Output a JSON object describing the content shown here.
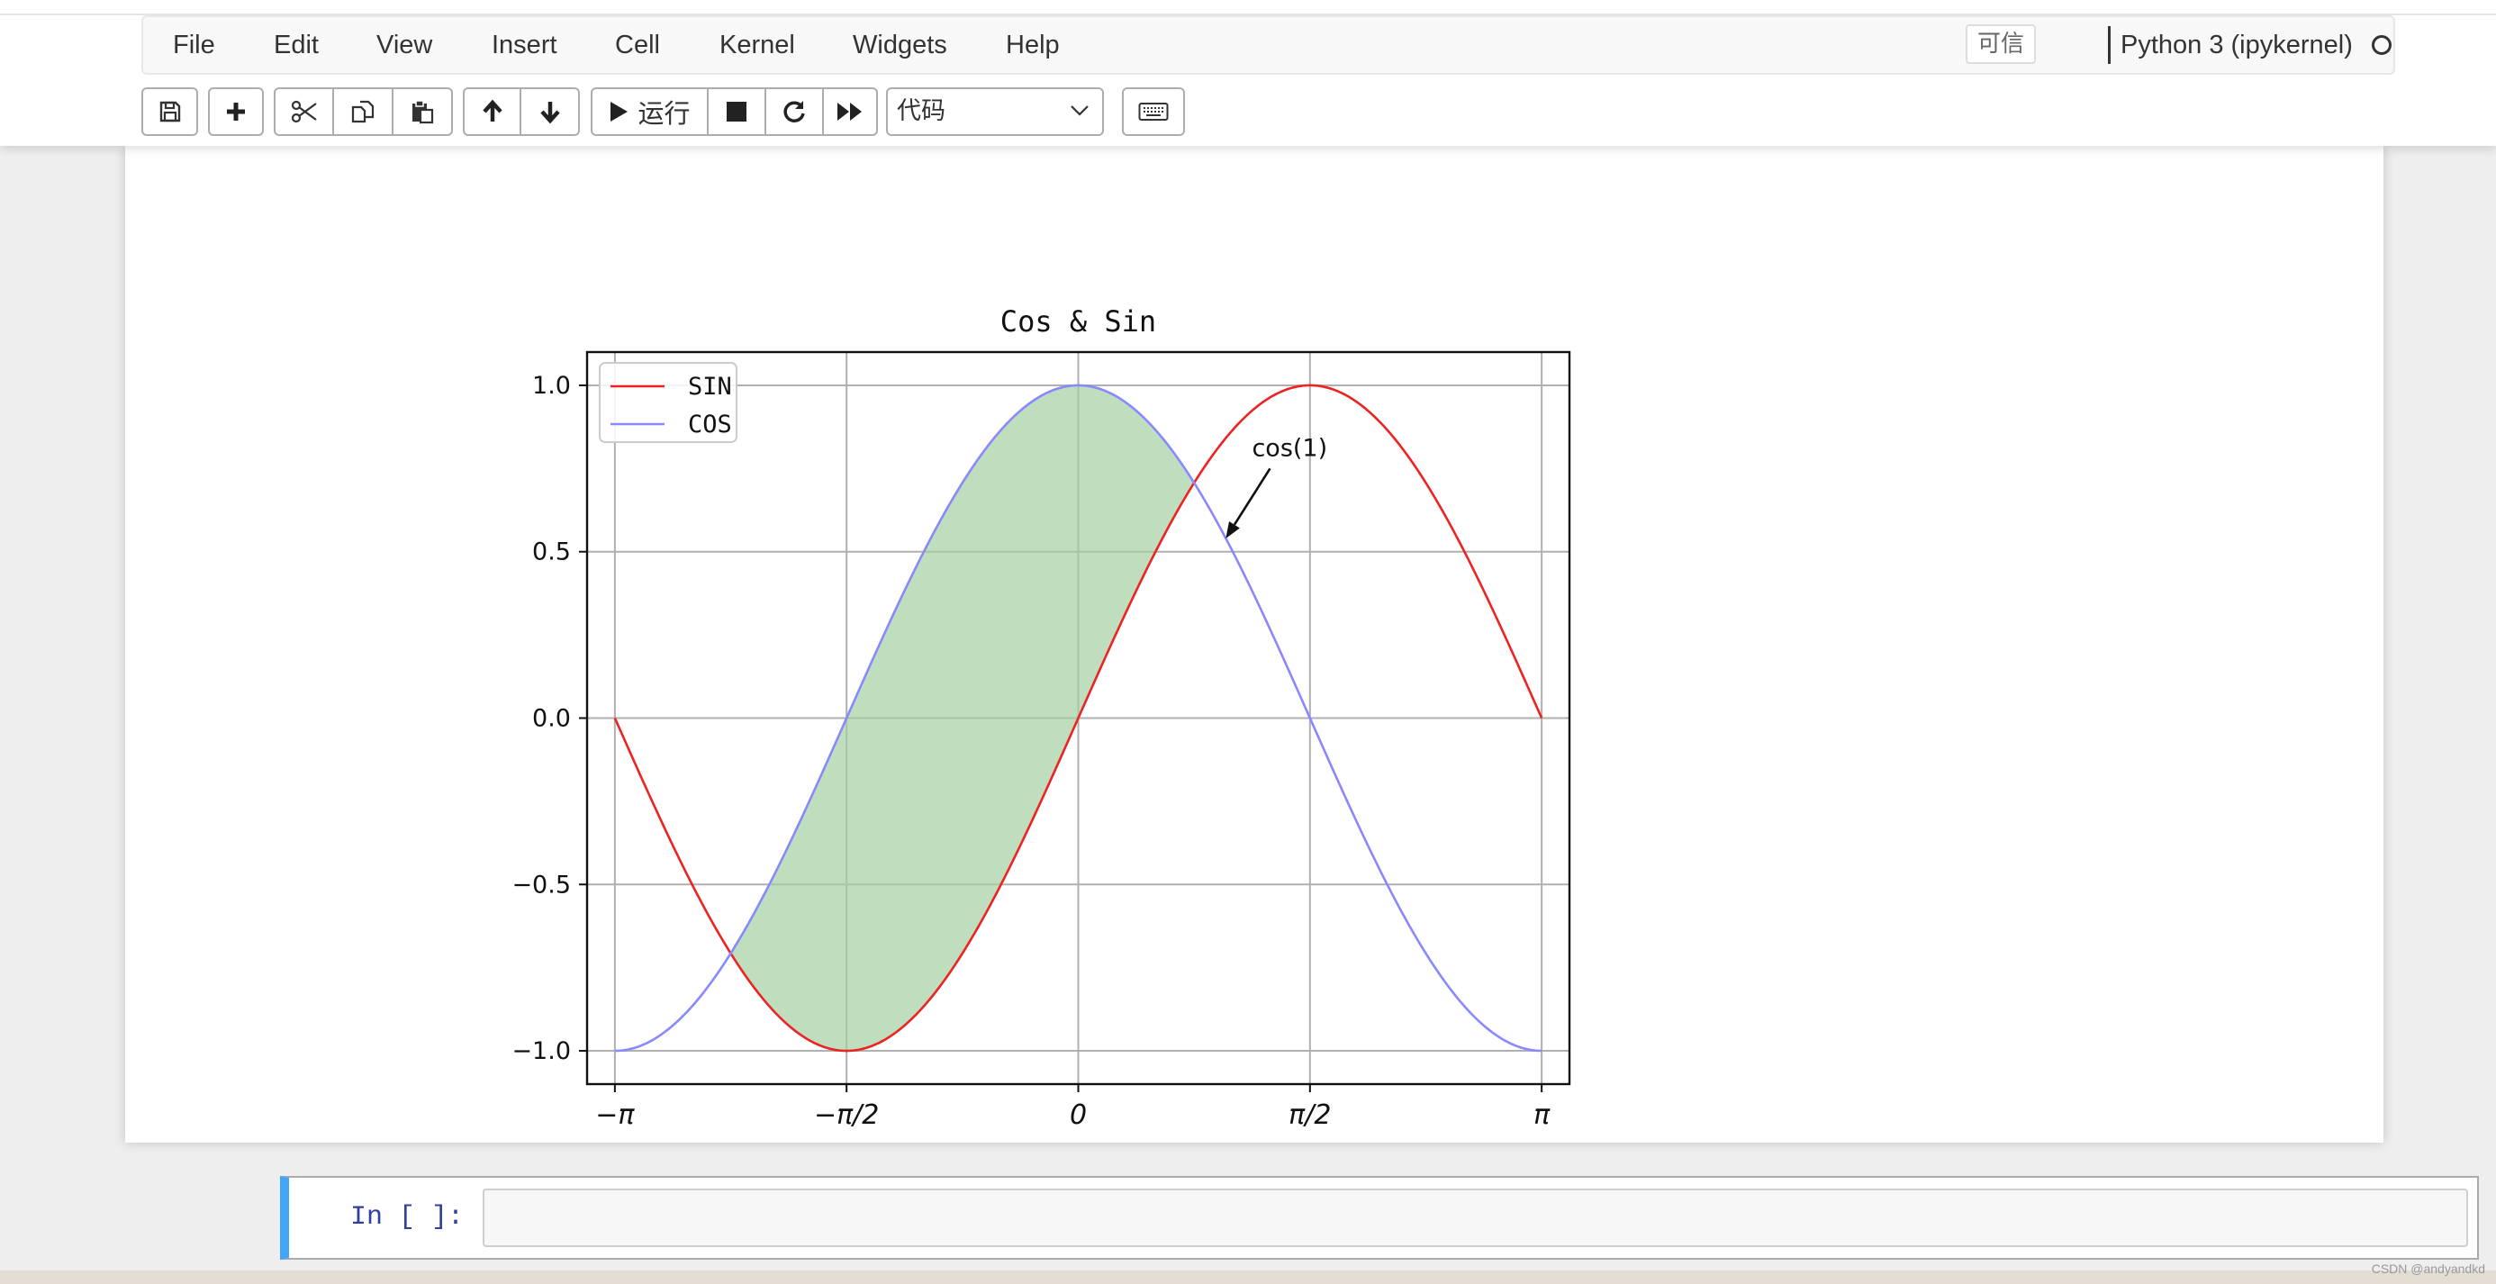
{
  "menu": {
    "items": [
      "File",
      "Edit",
      "View",
      "Insert",
      "Cell",
      "Kernel",
      "Widgets",
      "Help"
    ],
    "trusted": "可信",
    "kernel": "Python 3 (ipykernel)"
  },
  "toolbar": {
    "buttons": [
      "save-icon",
      "plus-icon",
      "scissors-icon",
      "copy-icon",
      "paste-icon",
      "arrow-up-icon",
      "arrow-down-icon",
      "play-icon",
      "stop-icon",
      "restart-icon",
      "fast-forward-icon",
      "keyboard-icon"
    ],
    "run_label": "运行",
    "cell_type": "代码"
  },
  "cell": {
    "prompt": "In [ ]:",
    "code": ""
  },
  "chart_data": {
    "type": "line",
    "title": "Cos & Sin",
    "xlabel": "",
    "ylabel": "",
    "xlim": [
      -3.33,
      3.33
    ],
    "ylim": [
      -1.1,
      1.1
    ],
    "x_ticks": [
      -3.14159,
      -1.5708,
      0,
      1.5708,
      3.14159
    ],
    "x_tick_labels": [
      "−π",
      "−π/2",
      "0",
      "π/2",
      "π"
    ],
    "y_ticks": [
      -1.0,
      -0.5,
      0.0,
      0.5,
      1.0
    ],
    "y_tick_labels": [
      "−1.0",
      "−0.5",
      "0.0",
      "0.5",
      "1.0"
    ],
    "grid": true,
    "legend": "top-left",
    "series": [
      {
        "name": "SIN",
        "function": "sin",
        "color": "#ee2222",
        "x_range": [
          -3.14159,
          3.14159
        ]
      },
      {
        "name": "COS",
        "function": "cos",
        "color": "#8888ff",
        "x_range": [
          -3.14159,
          3.14159
        ]
      }
    ],
    "fill_between": {
      "where": "cos > sin",
      "color": "#a2d0a2"
    },
    "annotation": {
      "text": "cos(1)",
      "point": [
        1.0,
        0.54
      ],
      "text_position": [
        1.3,
        0.75
      ]
    }
  }
}
